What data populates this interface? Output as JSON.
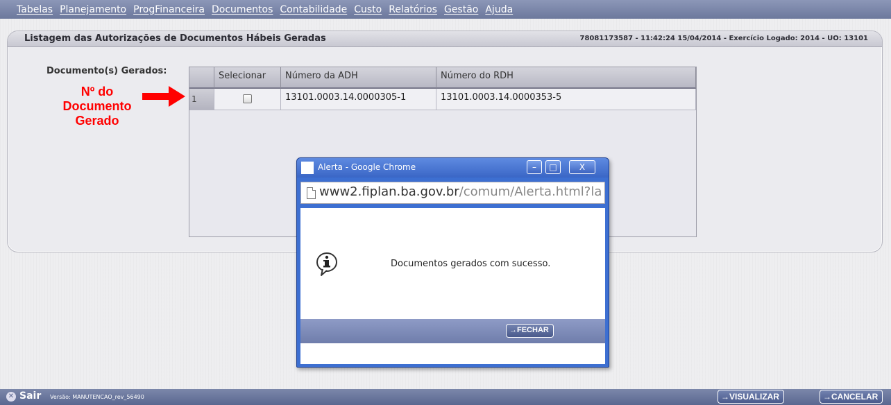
{
  "menu": {
    "items": [
      "Tabelas",
      "Planejamento",
      "ProgFinanceira",
      "Documentos",
      "Contabilidade",
      "Custo",
      "Relatórios",
      "Gestão",
      "Ajuda"
    ]
  },
  "panel": {
    "title": "Listagem das Autorizações de Documentos Hábeis Geradas",
    "session_info": "78081173587 - 11:42:24 15/04/2014 - Exercício Logado: 2014 - UO: 13101",
    "docs_label": "Documento(s) Gerados:"
  },
  "grid": {
    "columns": [
      "",
      "Selecionar",
      "Número da ADH",
      "Número do RDH"
    ],
    "rows": [
      {
        "index": "1",
        "selected": false,
        "adh": "13101.0003.14.0000305-1",
        "rdh": "13101.0003.14.0000353-5"
      }
    ]
  },
  "annotation": {
    "text": "Nº do Documento Gerado",
    "color": "#ff0000"
  },
  "dialog": {
    "title": "Alerta - Google Chrome",
    "url_host": "www2.fiplan.ba.gov.br",
    "url_path": "/comum/Alerta.html?la",
    "message": "Documentos gerados com sucesso.",
    "close_button": "→FECHAR"
  },
  "statusbar": {
    "exit_label": "Sair",
    "version": "Versão: MANUTENCAO_rev_56490",
    "view_button": "→VISUALIZAR",
    "cancel_button": "→CANCELAR"
  },
  "colors": {
    "menu_bar": "#7b87aa",
    "dialog_frame": "#3d6fd1",
    "annotation": "#ff0000"
  }
}
